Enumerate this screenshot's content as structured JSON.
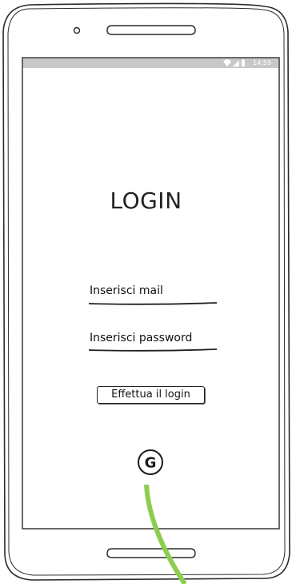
{
  "status_bar": {
    "time": "14:59"
  },
  "screen": {
    "title": "LOGIN",
    "email_placeholder": "Inserisci mail",
    "password_placeholder": "Inserisci password",
    "login_button": "Effettua il login",
    "google_icon_glyph": "G"
  },
  "colors": {
    "status_bar": "#c8c8c8",
    "connector": "#8ccd4f",
    "outline": "#2b2b2b"
  },
  "icons": [
    "wifi-icon",
    "signal-icon",
    "battery-icon",
    "google-icon"
  ]
}
